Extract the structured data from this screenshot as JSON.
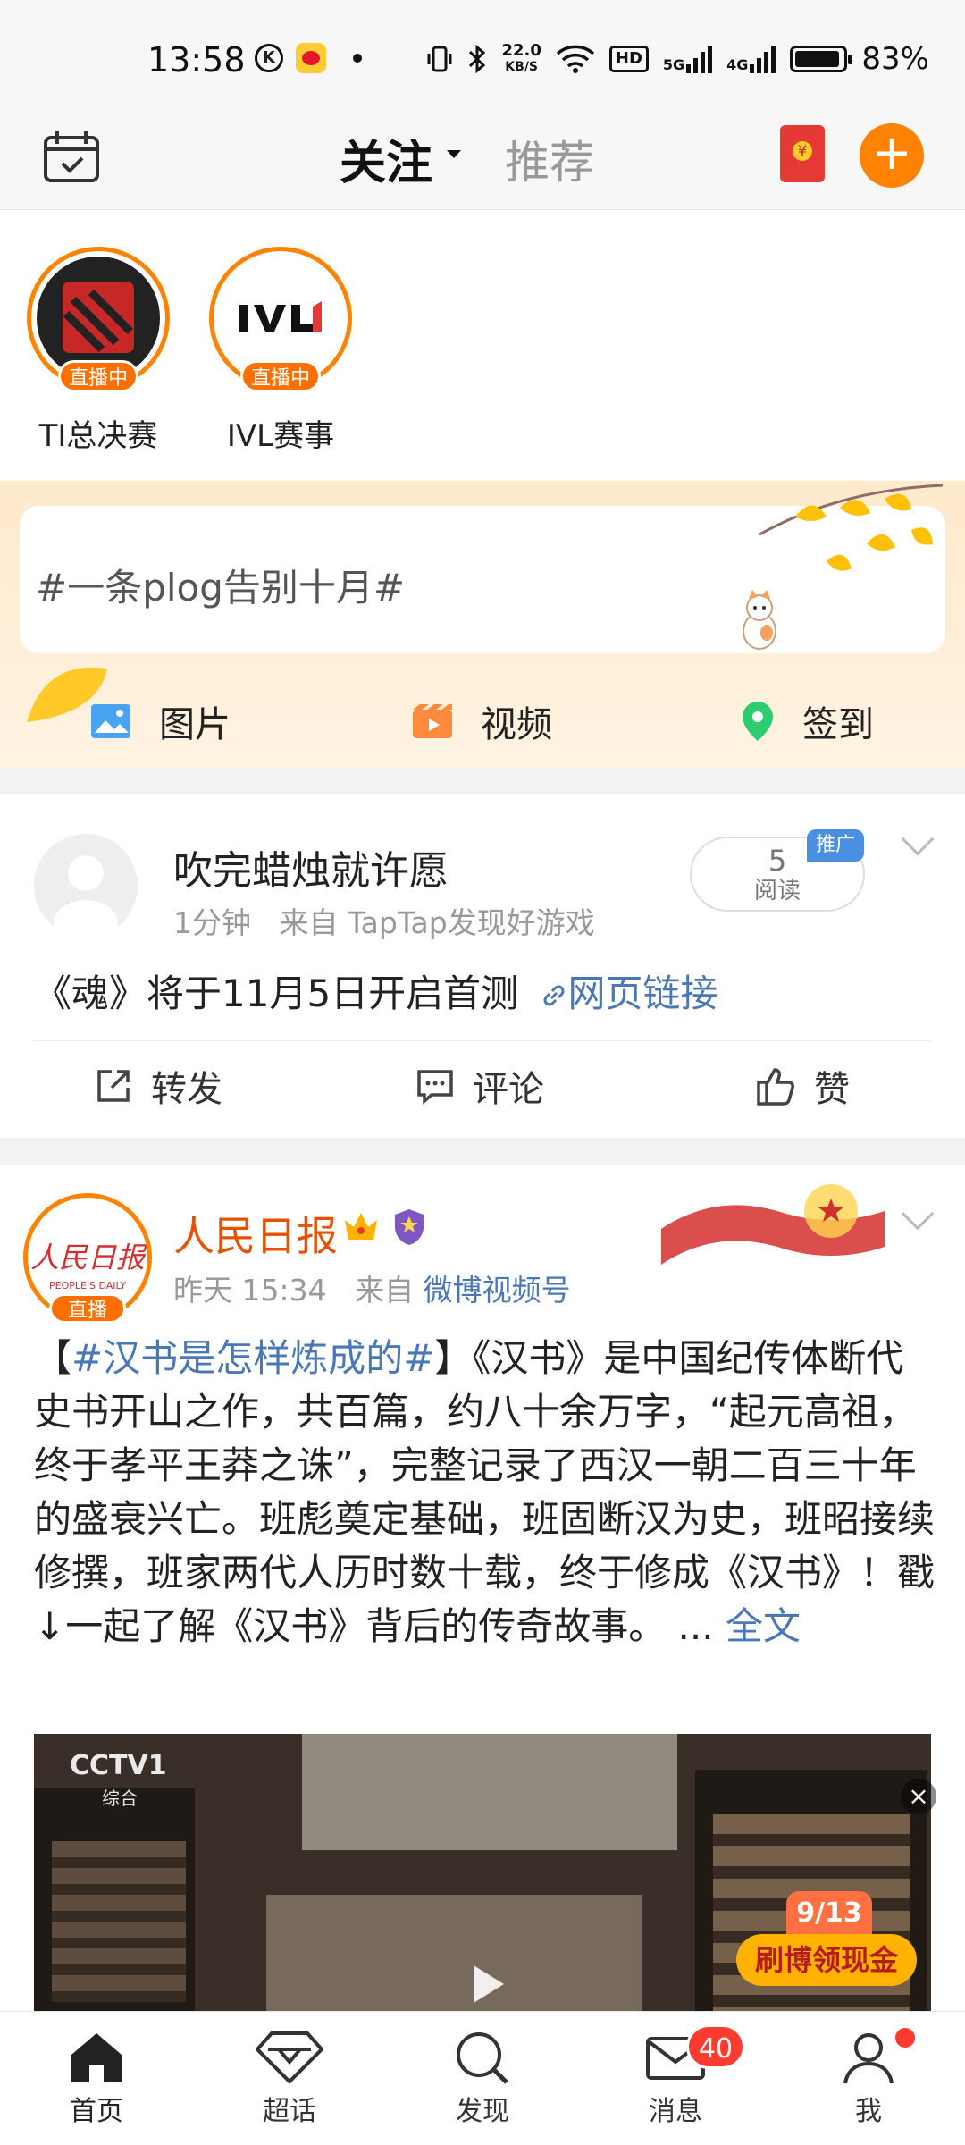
{
  "status_bar": {
    "time": "13:58",
    "net_speed_value": "22.0",
    "net_speed_unit": "KB/S",
    "hd_label": "HD",
    "signal_1_type": "5G",
    "signal_2_type": "4G",
    "battery_percent": "83%",
    "battery_level": 0.83
  },
  "header": {
    "tab_follow": "关注",
    "tab_recommend": "推荐"
  },
  "live": {
    "items": [
      {
        "name": "TI总决赛",
        "badge": "直播中"
      },
      {
        "name": "IVL赛事",
        "badge": "直播中"
      }
    ]
  },
  "compose": {
    "topic": "#一条plog告别十月#",
    "actions": [
      "图片",
      "视频",
      "签到"
    ]
  },
  "post_ad": {
    "author": "吹完蜡烛就许愿",
    "time": "1分钟",
    "source": "来自 TapTap发现好游戏",
    "read_count": "5",
    "read_label": "阅读",
    "promo_tag": "推广",
    "text": "《魂》将于11月5日开启首测",
    "link_text": "网页链接",
    "actions": [
      "转发",
      "评论",
      "赞"
    ]
  },
  "post_news": {
    "author": "人民日报",
    "avatar_logo": "人民日报",
    "avatar_en": "PEOPLE'S DAILY",
    "live_badge": "直播",
    "time": "昨天 15:34",
    "source_prefix": "来自",
    "source": "微博视频号",
    "body_open": "【",
    "hashtag": "#汉书是怎样炼成的#",
    "body_rest": "】《汉书》是中国纪传体断代史书开山之作，共百篇，约八十余万字，“起元高祖，终于孝平王莽之诛”，完整记录了西汉一朝二百三十年的盛衰兴亡。班彪奠定基础，班固断汉为史，班昭接续修撰，班家两代人历时数十载，终于修成《汉书》！戳↓一起了解《汉书》背后的传奇故事。",
    "ellipsis": " ... ",
    "more": "全文",
    "video_channel": "CCTV1",
    "video_channel_sub": "综合",
    "promo_count": "9/13",
    "promo_button": "刷博领现金",
    "close_glyph": "×"
  },
  "bottom_nav": {
    "items": [
      {
        "label": "首页"
      },
      {
        "label": "超话"
      },
      {
        "label": "发现"
      },
      {
        "label": "消息",
        "badge": "40"
      },
      {
        "label": "我"
      }
    ]
  },
  "colors": {
    "accent_orange": "#ff8200",
    "link_blue": "#4a78b5",
    "badge_red": "#ff3b30"
  },
  "icons": [
    "calendar-icon",
    "red-packet-icon",
    "plus-icon",
    "image-icon",
    "video-icon",
    "location-icon",
    "share-icon",
    "comment-icon",
    "like-icon",
    "home-icon",
    "super-topic-icon",
    "discover-icon",
    "message-icon",
    "profile-icon"
  ]
}
